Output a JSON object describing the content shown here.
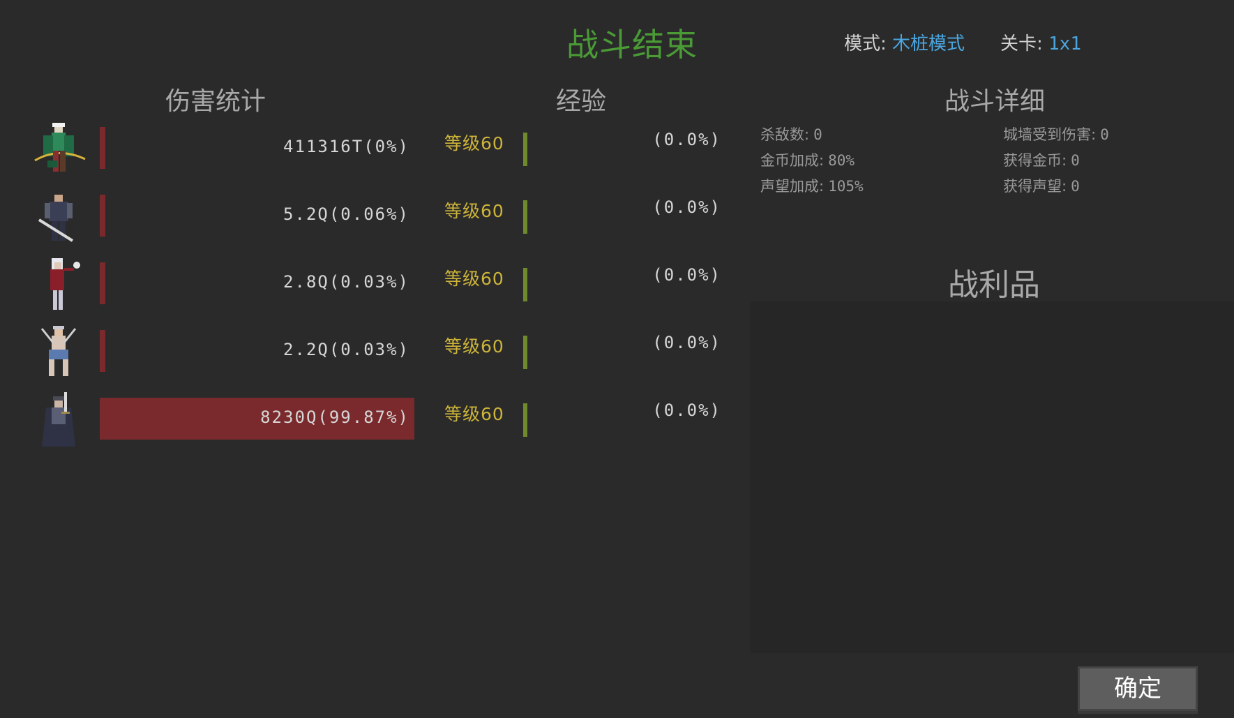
{
  "header": {
    "title": "战斗结束",
    "mode_label": "模式:",
    "mode_value": "木桩模式",
    "stage_label": "关卡:",
    "stage_value": "1x1"
  },
  "sections": {
    "damage": "伤害统计",
    "exp": "经验",
    "details": "战斗详细",
    "loot": "战利品"
  },
  "heroes": [
    {
      "avatar": "archer-hero-icon",
      "damage": "411316T(0%)",
      "damage_pct": 0.0,
      "level": "等级60",
      "exp": "(0.0%)"
    },
    {
      "avatar": "swordsman-hero-icon",
      "damage": "5.2Q(0.06%)",
      "damage_pct": 0.06,
      "level": "等级60",
      "exp": "(0.0%)"
    },
    {
      "avatar": "mage-hero-icon",
      "damage": "2.8Q(0.03%)",
      "damage_pct": 0.03,
      "level": "等级60",
      "exp": "(0.0%)"
    },
    {
      "avatar": "dancer-hero-icon",
      "damage": "2.2Q(0.03%)",
      "damage_pct": 0.03,
      "level": "等级60",
      "exp": "(0.0%)"
    },
    {
      "avatar": "knight-hero-icon",
      "damage": "8230Q(99.87%)",
      "damage_pct": 99.87,
      "level": "等级60",
      "exp": "(0.0%)"
    }
  ],
  "details": {
    "kills_label": "杀敌数:",
    "kills": "0",
    "wall_dmg_label": "城墙受到伤害:",
    "wall_dmg": "0",
    "gold_bonus_label": "金币加成:",
    "gold_bonus": "80%",
    "gold_gain_label": "获得金币:",
    "gold_gain": "0",
    "fame_bonus_label": "声望加成:",
    "fame_bonus": "105%",
    "fame_gain_label": "获得声望:",
    "fame_gain": "0"
  },
  "confirm_label": "确定",
  "colors": {
    "background": "#2a2a2a",
    "title": "#4a9a36",
    "accent_blue": "#4aa6e0",
    "damage_bar": "#7a2a2c",
    "level_gold": "#cdb43a",
    "exp_bar": "#6f8a2c"
  }
}
